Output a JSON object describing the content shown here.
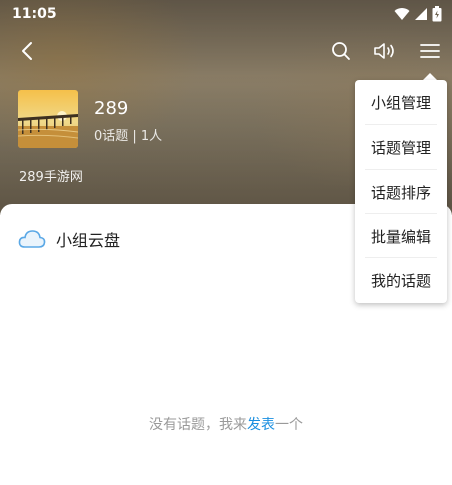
{
  "status_bar": {
    "time": "11:05"
  },
  "nav": {
    "back_icon": "back-arrow-icon",
    "search_icon": "search-icon",
    "sound_icon": "volume-icon",
    "menu_icon": "hamburger-menu-icon"
  },
  "group": {
    "name": "289",
    "stats": "0话题 | 1人",
    "site": "289手游网"
  },
  "cloud": {
    "icon": "cloud-icon",
    "label": "小组云盘"
  },
  "empty": {
    "prefix": "没有话题，我来",
    "link": "发表",
    "suffix": "一个"
  },
  "menu": {
    "items": [
      {
        "label": "小组管理"
      },
      {
        "label": "话题管理"
      },
      {
        "label": "话题排序"
      },
      {
        "label": "批量编辑"
      },
      {
        "label": "我的话题"
      }
    ]
  },
  "colors": {
    "accent": "#1a8fe0",
    "muted_text": "#9a9a9a"
  }
}
